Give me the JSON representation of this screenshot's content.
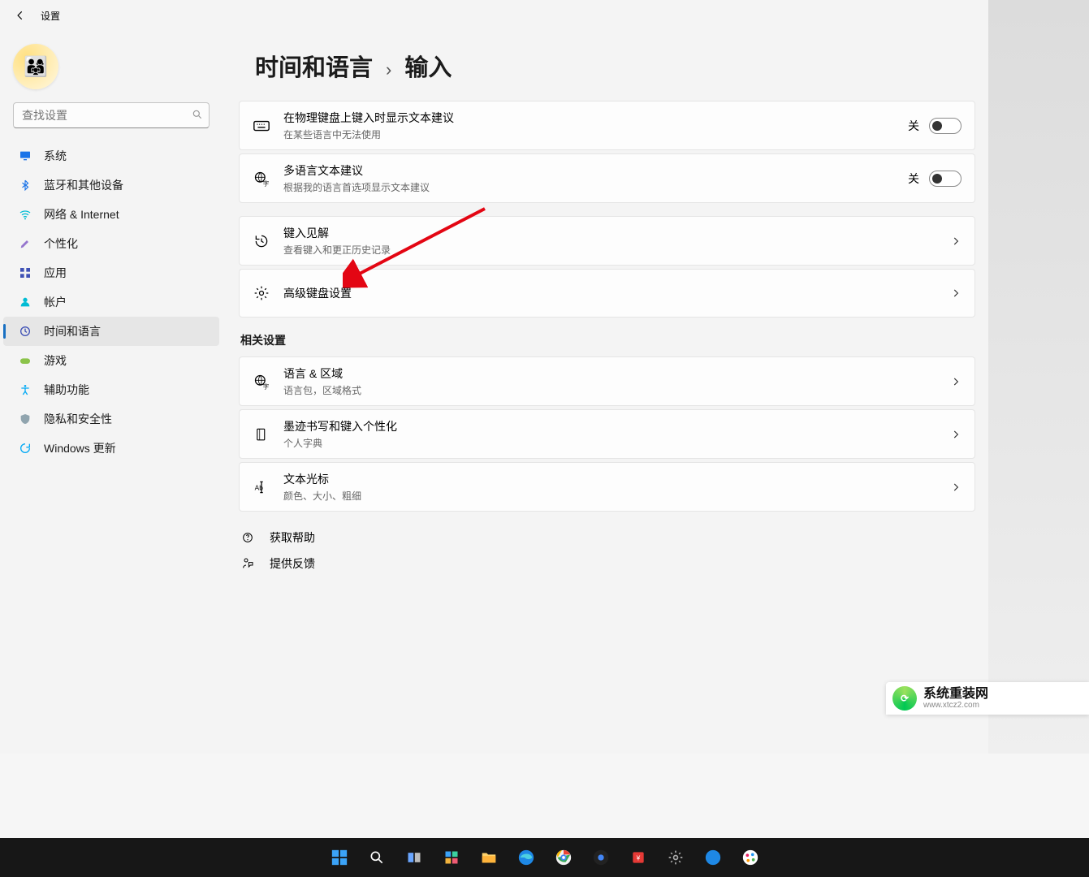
{
  "app_title": "设置",
  "avatar_emoji": "👨‍👩‍👧",
  "search_placeholder": "查找设置",
  "nav": [
    {
      "label": "系统",
      "color": "#1a73e8"
    },
    {
      "label": "蓝牙和其他设备",
      "color": "#1a73e8"
    },
    {
      "label": "网络 & Internet",
      "color": "#00bcd4"
    },
    {
      "label": "个性化",
      "color": "#9c27b0"
    },
    {
      "label": "应用",
      "color": "#3f51b5"
    },
    {
      "label": "帐户",
      "color": "#00bcd4"
    },
    {
      "label": "时间和语言",
      "color": "#3f51b5",
      "active": true
    },
    {
      "label": "游戏",
      "color": "#8bc34a"
    },
    {
      "label": "辅助功能",
      "color": "#03a9f4"
    },
    {
      "label": "隐私和安全性",
      "color": "#607d8b"
    },
    {
      "label": "Windows 更新",
      "color": "#03a9f4"
    }
  ],
  "breadcrumb": {
    "parent": "时间和语言",
    "sep": "›",
    "current": "输入"
  },
  "cards": [
    {
      "icon": "keyboard",
      "title": "在物理键盘上键入时显示文本建议",
      "sub": "在某些语言中无法使用",
      "trailing": "toggle",
      "state_label": "关"
    },
    {
      "icon": "globe",
      "title": "多语言文本建议",
      "sub": "根据我的语言首选项显示文本建议",
      "trailing": "toggle",
      "state_label": "关"
    },
    {
      "icon": "history",
      "title": "键入见解",
      "sub": "查看键入和更正历史记录",
      "trailing": "chevron"
    },
    {
      "icon": "gear",
      "title": "高级键盘设置",
      "sub": "",
      "trailing": "chevron"
    }
  ],
  "related_heading": "相关设置",
  "related": [
    {
      "icon": "globe",
      "title": "语言 & 区域",
      "sub": "语言包，区域格式",
      "trailing": "chevron"
    },
    {
      "icon": "book",
      "title": "墨迹书写和键入个性化",
      "sub": "个人字典",
      "trailing": "chevron"
    },
    {
      "icon": "cursor",
      "title": "文本光标",
      "sub": "颜色、大小、粗细",
      "trailing": "chevron"
    }
  ],
  "links": [
    {
      "icon": "help",
      "label": "获取帮助"
    },
    {
      "icon": "feedback",
      "label": "提供反馈"
    }
  ],
  "watermark": {
    "title": "系统重装网",
    "sub": "www.xtcz2.com"
  }
}
